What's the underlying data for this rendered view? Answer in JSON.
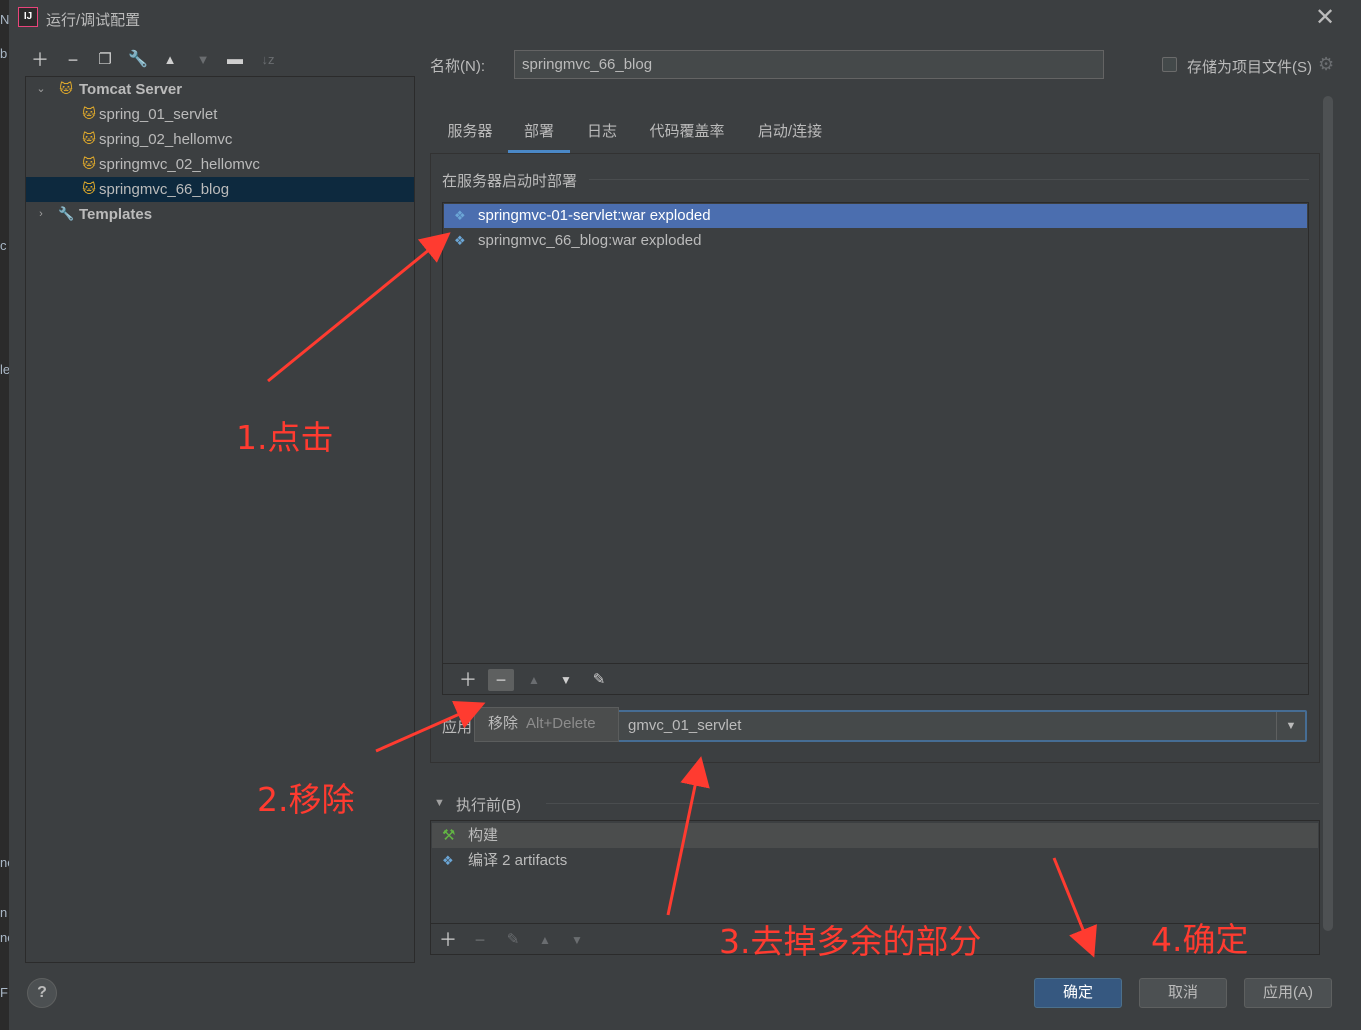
{
  "window": {
    "title": "运行/调试配置",
    "app_logo": "IJ"
  },
  "bg_strip": [
    "N",
    "b",
    "c",
    "le",
    "ne",
    "n",
    "ne",
    "F"
  ],
  "toolbar": {
    "icons": [
      "add-icon",
      "remove-icon",
      "copy-icon",
      "wrench-icon",
      "move-up-icon",
      "move-down-icon",
      "new-folder-icon",
      "sort-icon"
    ]
  },
  "tree": {
    "group": "Tomcat Server",
    "items": [
      "spring_01_servlet",
      "spring_02_hellomvc",
      "springmvc_02_hellomvc",
      "springmvc_66_blog"
    ],
    "templates": "Templates"
  },
  "name": {
    "label": "名称(N):",
    "value": "springmvc_66_blog"
  },
  "store_as_project_file": {
    "label": "存储为项目文件(S)",
    "checked": false
  },
  "tabs": [
    "服务器",
    "部署",
    "日志",
    "代码覆盖率",
    "启动/连接"
  ],
  "active_tab": "部署",
  "deploy": {
    "heading": "在服务器启动时部署",
    "items": [
      "springmvc-01-servlet:war exploded",
      "springmvc_66_blog:war exploded"
    ],
    "selected_index": 0
  },
  "tooltip": {
    "text": "移除",
    "shortcut": "Alt+Delete"
  },
  "app_context": {
    "label": "应用",
    "value": "gmvc_01_servlet"
  },
  "before_launch": {
    "label": "执行前(B)",
    "items": [
      "构建",
      "编译 2 artifacts"
    ]
  },
  "buttons": {
    "help": "?",
    "ok": "确定",
    "cancel": "取消",
    "apply": "应用(A)"
  },
  "annotations": [
    "1.点击",
    "2.移除",
    "3.去掉多余的部分",
    "4.确定"
  ],
  "colors": {
    "accent": "#4b6eaf",
    "annotation": "#ff3b30",
    "primary_button": "#365880"
  }
}
